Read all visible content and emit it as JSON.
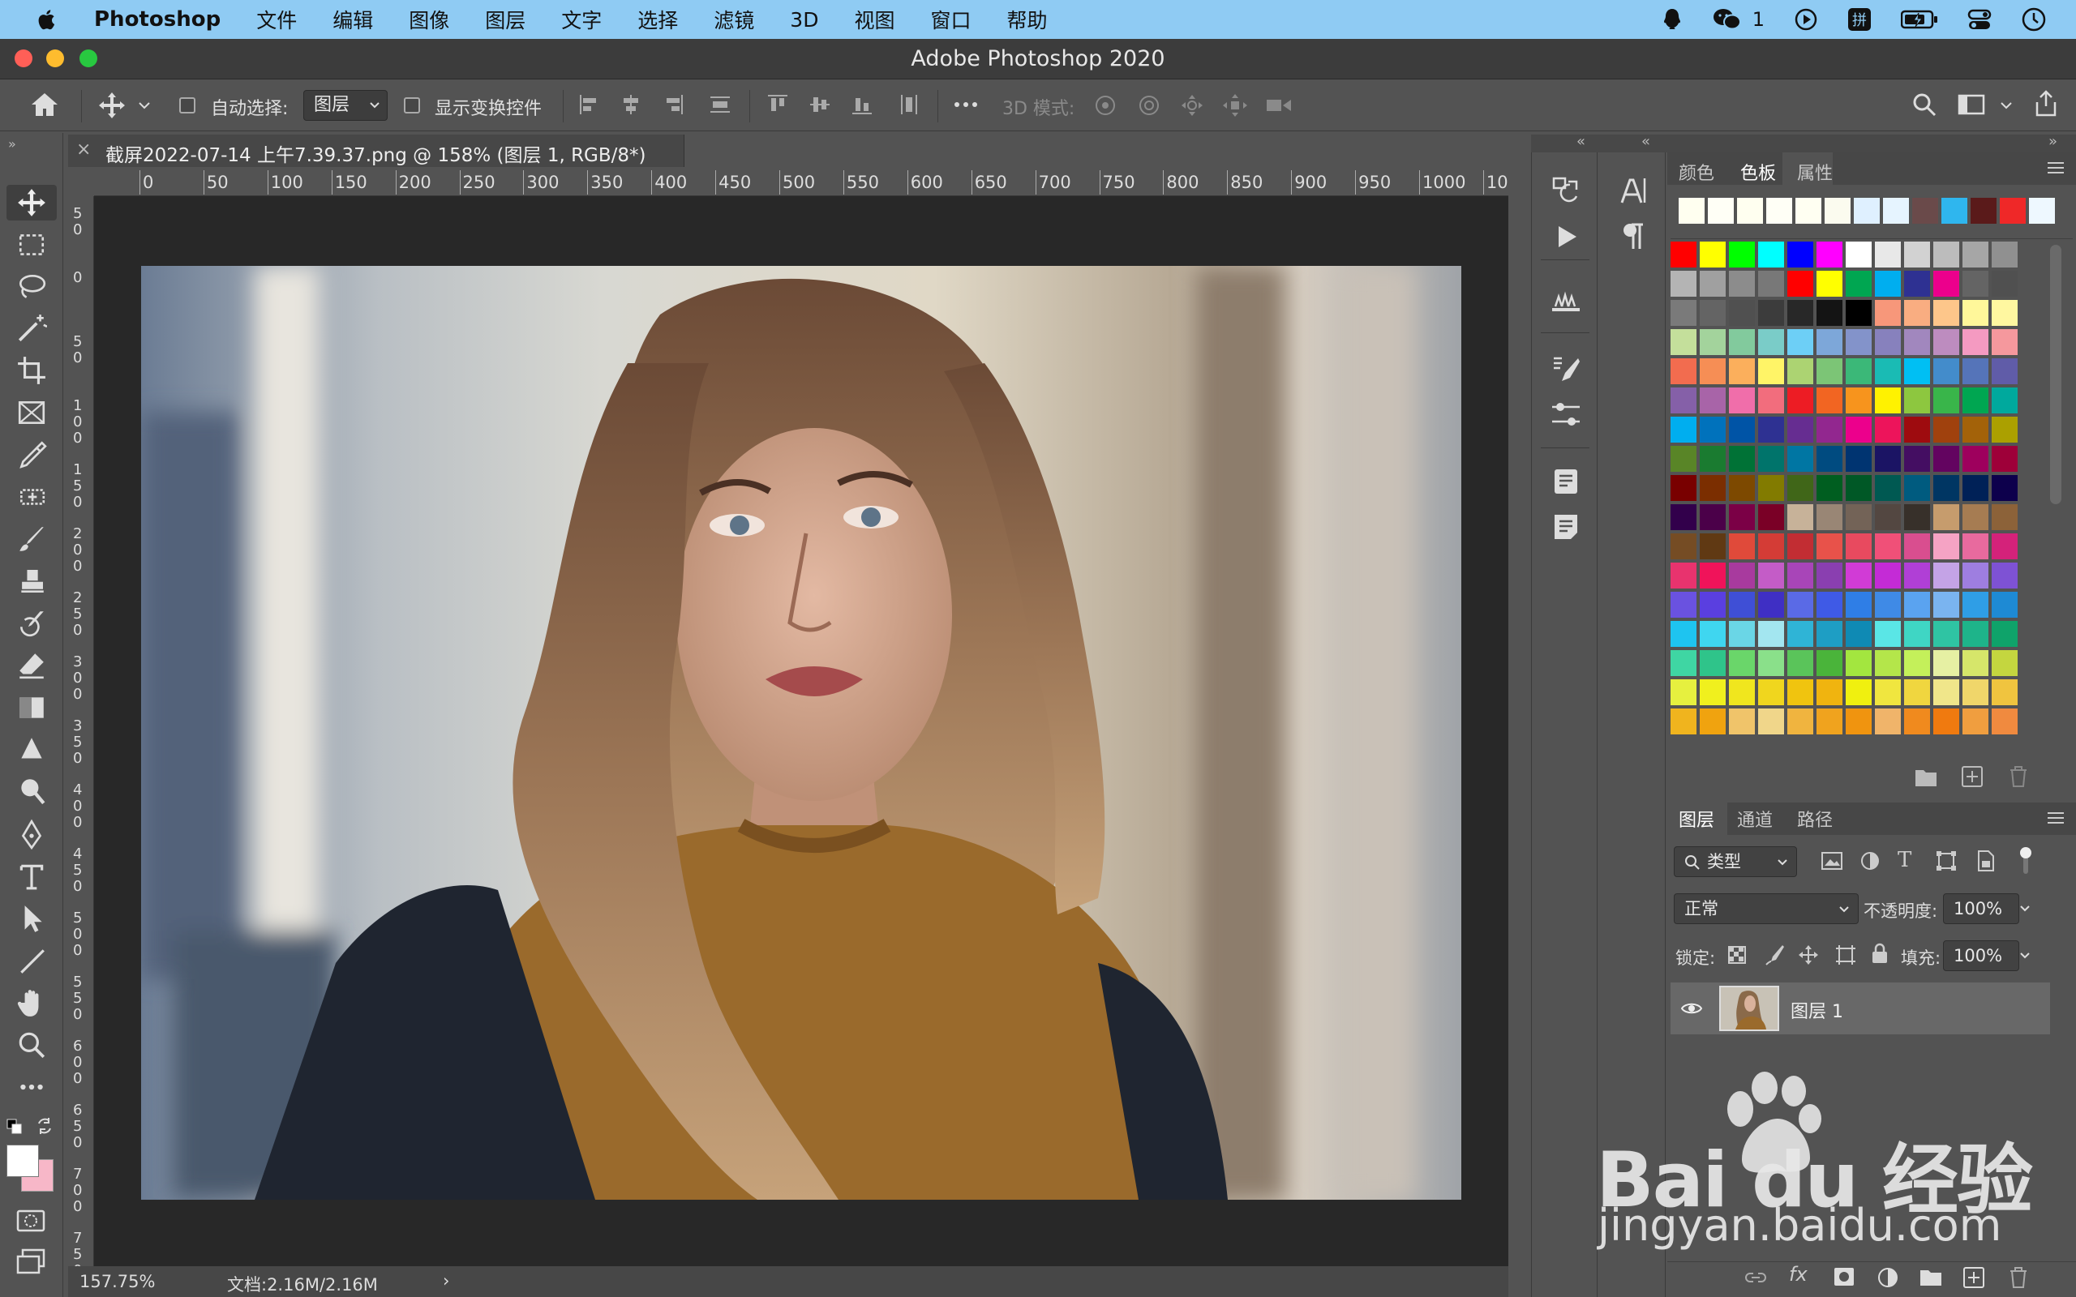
{
  "menubar": {
    "app_name": "Photoshop",
    "items": [
      "文件",
      "编辑",
      "图像",
      "图层",
      "文字",
      "选择",
      "滤镜",
      "3D",
      "视图",
      "窗口",
      "帮助"
    ],
    "wechat_count": "1"
  },
  "window": {
    "title": "Adobe Photoshop 2020"
  },
  "options": {
    "auto_select_label": "自动选择:",
    "auto_select_value": "图层",
    "show_transform_label": "显示变换控件",
    "mode_3d_label": "3D 模式:"
  },
  "document": {
    "tab_title": "截屏2022-07-14 上午7.39.37.png @ 158% (图层 1, RGB/8*)",
    "ruler_h_ticks": [
      "0",
      "50",
      "100",
      "150",
      "200",
      "250",
      "300",
      "350",
      "400",
      "450",
      "500",
      "550",
      "600",
      "650",
      "700",
      "750",
      "800",
      "850",
      "900",
      "950",
      "1000",
      "10"
    ],
    "ruler_v_ticks": [
      "5\n0",
      "0",
      "5\n0",
      "1\n0\n0",
      "1\n5\n0",
      "2\n0\n0",
      "2\n5\n0",
      "3\n0\n0",
      "3\n5\n0",
      "4\n0\n0",
      "4\n5\n0",
      "5\n0\n0",
      "5\n5\n0",
      "6\n0\n0",
      "6\n5\n0",
      "7\n0\n0",
      "7\n5\n0"
    ],
    "zoom": "157.75%",
    "doc_info": "文档:2.16M/2.16M"
  },
  "swatches_panel": {
    "tabs": [
      "颜色",
      "色板",
      "属性"
    ],
    "active_tab": "色板",
    "recent": [
      "#fffff0",
      "#fffff6",
      "#fffff0",
      "#fffff6",
      "#fffff2",
      "#fbfbef",
      "#dff0ff",
      "#e6f4ff",
      "#6a4a4a",
      "#2fb6ee",
      "#5a1a1a",
      "#ef2828",
      "#eef8ff"
    ],
    "grid": [
      [
        "#ff0000",
        "#ffff00",
        "#00ff00",
        "#00ffff",
        "#0000ff",
        "#ff00ff",
        "#ffffff",
        "#e8e8e8",
        "#d2d2d2",
        "#bcbcbc",
        "#a6a6a6",
        "#909090"
      ],
      [
        "#b4b4b4",
        "#a0a0a0",
        "#8c8c8c",
        "#787878",
        "#ff0000",
        "#ffff00",
        "#00a651",
        "#00aeef",
        "#2e3192",
        "#ec008c",
        "#646464",
        "#505050"
      ],
      [
        "#7a7a7a",
        "#646464",
        "#505050",
        "#3c3c3c",
        "#282828",
        "#141414",
        "#000000",
        "#f7977a",
        "#f9ad81",
        "#fdc68a",
        "#fff79a",
        "#fff7a0"
      ],
      [
        "#c4df9b",
        "#a3d39c",
        "#82ca9d",
        "#7accc8",
        "#6dcff6",
        "#7da7d9",
        "#8393ca",
        "#8781bd",
        "#a187be",
        "#bd8cbf",
        "#f49ac1",
        "#f5989d"
      ],
      [
        "#f26c4f",
        "#f68e55",
        "#fbaf5c",
        "#fff467",
        "#acd372",
        "#7cc576",
        "#3bb878",
        "#1abbb4",
        "#00bff3",
        "#438ccb",
        "#5574b9",
        "#605ca8"
      ],
      [
        "#8560a8",
        "#a864a8",
        "#f06eaa",
        "#f26d7d",
        "#ed1c24",
        "#f26522",
        "#f7941d",
        "#fff200",
        "#8dc73f",
        "#39b54a",
        "#00a651",
        "#00a99d"
      ],
      [
        "#00aeef",
        "#0072bc",
        "#0054a6",
        "#2e3192",
        "#662d91",
        "#92278f",
        "#ec008c",
        "#ed145b",
        "#9e0b0f",
        "#a0410d",
        "#a36209",
        "#aba000"
      ],
      [
        "#598527",
        "#1a7b30",
        "#007236",
        "#00746b",
        "#0076a3",
        "#004b80",
        "#003471",
        "#1b1464",
        "#440e62",
        "#630460",
        "#9e005d",
        "#9e0039"
      ],
      [
        "#790000",
        "#7b2e00",
        "#7d4900",
        "#827b00",
        "#406618",
        "#005e20",
        "#005826",
        "#005952",
        "#005b7f",
        "#003663",
        "#002157",
        "#0d004c"
      ],
      [
        "#32004b",
        "#4b0049",
        "#7b0046",
        "#7a0026",
        "#c7b299",
        "#998675",
        "#736357",
        "#534741",
        "#37302a",
        "#c69c6d",
        "#a67c52",
        "#8c6239"
      ],
      [
        "#754c24",
        "#603913",
        "#e04a3a",
        "#d43c36",
        "#c22d33",
        "#e8524a",
        "#e84a5f",
        "#f05078",
        "#d94e8f",
        "#f5a3c4",
        "#e86a9e",
        "#d4227a"
      ],
      [
        "#e8336e",
        "#f0135a",
        "#a83a9e",
        "#c45cc7",
        "#a845b8",
        "#8a3fb0",
        "#d13bd6",
        "#c42bd6",
        "#b03fd6",
        "#c4a3e6",
        "#9e7ee0",
        "#7e52d4"
      ],
      [
        "#6a52e0",
        "#5a3fe0",
        "#3f4fd6",
        "#3f2fc4",
        "#5a6ae6",
        "#3f5ae6",
        "#2f7ee6",
        "#3f8ae6",
        "#5aa3f0",
        "#7ab4f0",
        "#2f9ee6",
        "#1e8ad4"
      ],
      [
        "#1ec4f0",
        "#3fd6f0",
        "#6ad6e6",
        "#a3e6f0",
        "#2fb4d6",
        "#1e9ec4",
        "#0f8ab4",
        "#5ae6e6",
        "#3fd6c4",
        "#2fc4a3",
        "#1eb48a",
        "#0fa36a"
      ],
      [
        "#3fd6a3",
        "#2fc48a",
        "#6ad66a",
        "#8ae08a",
        "#5ac45a",
        "#4ab43a",
        "#a3e63f",
        "#b4e64a",
        "#c4f05a",
        "#e6f0a3",
        "#d6e66a",
        "#c4d63f"
      ],
      [
        "#e6f03f",
        "#f0f01e",
        "#f0e61e",
        "#f0d61e",
        "#f0c40f",
        "#f0b40f",
        "#f0f00f",
        "#f0e63f",
        "#f0d63f",
        "#f0e68a",
        "#f0d66a",
        "#f0c43f"
      ],
      [
        "#f0b41e",
        "#f0a30f",
        "#f0c46a",
        "#f0d68a",
        "#f0b43f",
        "#f0a31e",
        "#f0940f",
        "#f0b46a",
        "#f08a1e",
        "#f07a0f",
        "#f09e3f",
        "#f08a3f"
      ]
    ]
  },
  "layers_panel": {
    "tabs": [
      "图层",
      "通道",
      "路径"
    ],
    "active_tab": "图层",
    "filter_label": "类型",
    "blend_mode": "正常",
    "opacity_label": "不透明度:",
    "opacity_value": "100%",
    "lock_label": "锁定:",
    "fill_label": "填充:",
    "fill_value": "100%",
    "layers": [
      {
        "name": "图层 1",
        "visible": true
      }
    ]
  },
  "watermark": {
    "brand": "Bai du 经验",
    "url": "jingyan.baidu.com"
  },
  "colors": {
    "menubar_bg": "#8fcbf3",
    "panel_bg": "#535353",
    "canvas_bg": "#282828",
    "titlebar_bg": "#3c3c3c",
    "foreground_color": "#ffffff",
    "background_color": "#f7b7c8"
  }
}
